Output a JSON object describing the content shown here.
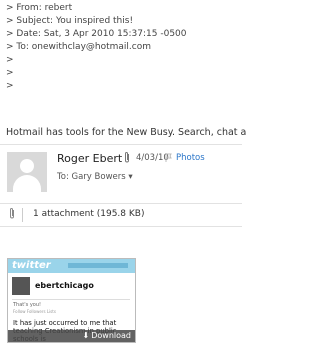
{
  "quoted": {
    "lines": [
      "> From: rebert",
      "> Subject: You inspired this!",
      "> Date: Sat, 3 Apr 2010 15:37:15 -0500",
      "> To: onewithclay@hotmail.com",
      ">",
      ">",
      ">"
    ]
  },
  "promo": {
    "text": "Hotmail has tools for the New Busy. Search, chat a"
  },
  "message": {
    "sender": "Roger Ebert",
    "date": "4/03/10",
    "flag_icon": "flag-icon",
    "photos_label": "Photos",
    "to_line": "To: Gary Bowers ▾"
  },
  "attachments": {
    "summary": "1 attachment (195.8 KB)"
  },
  "thumbnail": {
    "logo": "twitter",
    "username": "ebertchicago",
    "small_label": "That's you!",
    "small_meta": "Follow  Followers  Lists",
    "tweet": "It has just occurred to me that teaching Creationism in public schools is antidisestablishmentarianism",
    "download_label": "Download"
  },
  "colors": {
    "link": "#2b76c9",
    "twitter_header": "#9ad4ea",
    "download_bar": "#464646"
  }
}
